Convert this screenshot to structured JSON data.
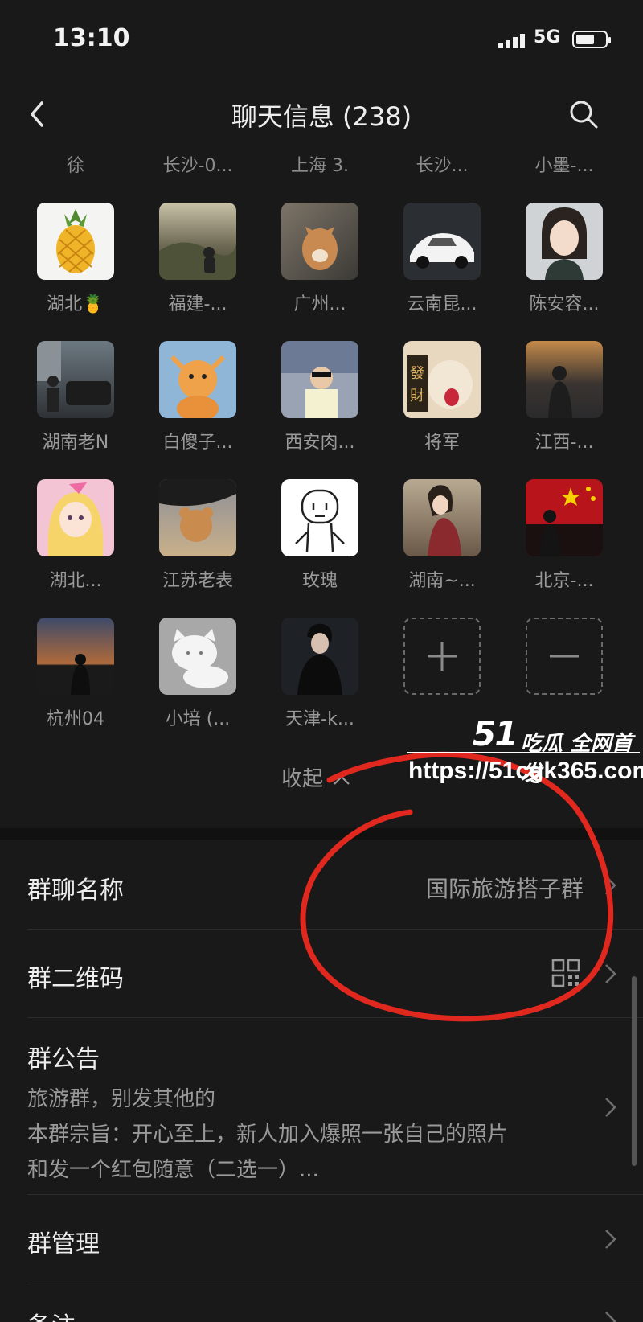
{
  "status_bar": {
    "time": "13:10",
    "network": "5G"
  },
  "header": {
    "title": "聊天信息 (238)"
  },
  "top_names": [
    "徐",
    "长沙-0...",
    "上海 3.",
    "长沙...",
    "小墨-..."
  ],
  "members": [
    {
      "name": "湖北🍍"
    },
    {
      "name": "福建-..."
    },
    {
      "name": "广州..."
    },
    {
      "name": "云南昆..."
    },
    {
      "name": "陈安容..."
    },
    {
      "name": "湖南老N"
    },
    {
      "name": "白傻子..."
    },
    {
      "name": "西安肉..."
    },
    {
      "name": "将军"
    },
    {
      "name": "江西-..."
    },
    {
      "name": "湖北..."
    },
    {
      "name": "江苏老表"
    },
    {
      "name": "玫瑰"
    },
    {
      "name": "湖南~..."
    },
    {
      "name": "北京-..."
    },
    {
      "name": "杭州04"
    },
    {
      "name": "小培 (..."
    },
    {
      "name": "天津-k..."
    }
  ],
  "collapse_label": "收起",
  "settings": {
    "group_name_label": "群聊名称",
    "group_name_value": "国际旅游搭子群",
    "qr_label": "群二维码",
    "notice_label": "群公告",
    "notice_lines": [
      "旅游群，别发其他的",
      "本群宗旨：开心至上，新人加入爆照一张自己的照片",
      "和发一个红包随意（二选一）..."
    ],
    "manage_label": "群管理",
    "remark_label": "备注"
  },
  "watermark": {
    "brand_number": "51",
    "tagline": "吃瓜 全网首发",
    "url": "https://51cgk365.com"
  },
  "colors": {
    "background": "#191919",
    "annotation_circle": "#e0281f"
  }
}
